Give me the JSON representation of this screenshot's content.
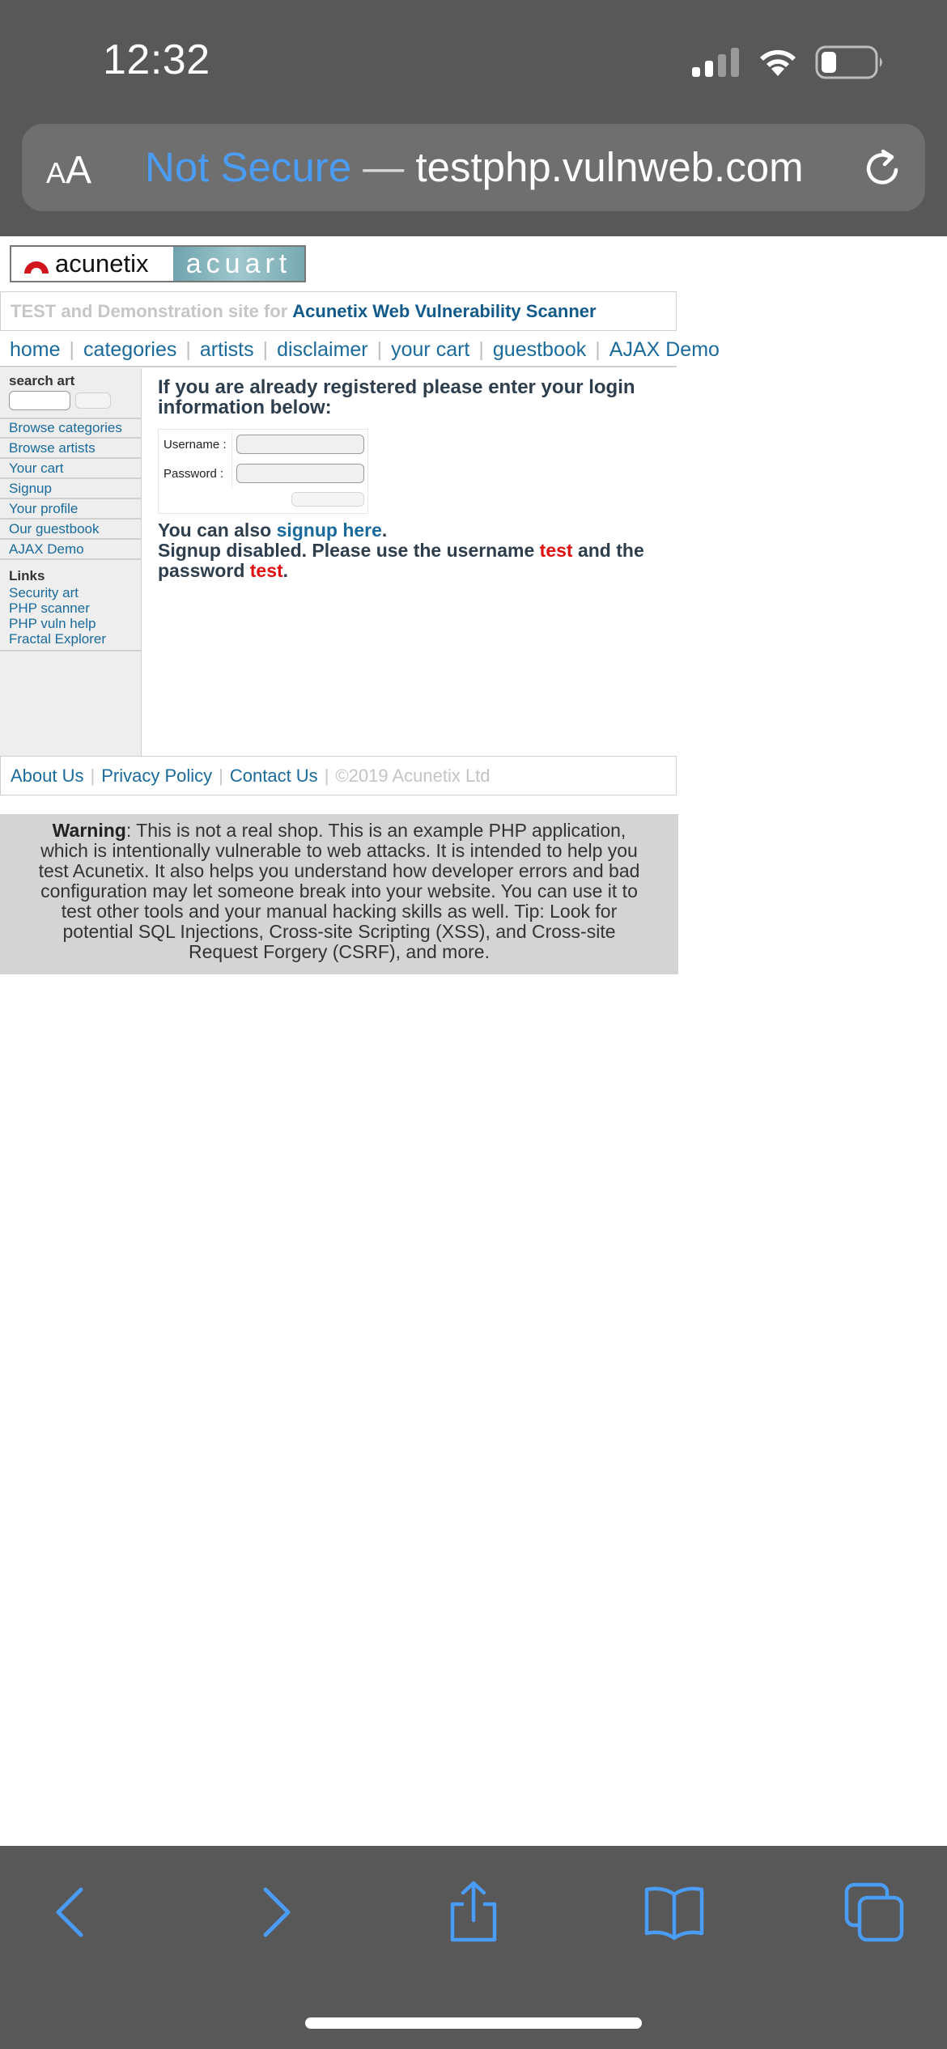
{
  "status_bar": {
    "time": "12:32",
    "icons": [
      "cellular-signal-icon",
      "wifi-icon",
      "battery-icon"
    ]
  },
  "address_bar": {
    "text_size_label_small": "A",
    "text_size_label_big": "A",
    "security_label": "Not Secure",
    "separator": " — ",
    "host": "testphp.vulnweb.com",
    "reload_icon": "reload-icon"
  },
  "site": {
    "logo_left_text": "acunetix",
    "logo_right_text": "acuart",
    "tagline_prefix": "TEST and Demonstration site for",
    "tagline_product": "Acunetix Web Vulnerability Scanner",
    "nav": [
      "home",
      "categories",
      "artists",
      "disclaimer",
      "your cart",
      "guestbook",
      "AJAX Demo"
    ]
  },
  "sidebar": {
    "search_label": "search art",
    "items": [
      "Browse categories",
      "Browse artists",
      "Your cart",
      "Signup",
      "Your profile",
      "Our guestbook",
      "AJAX Demo"
    ],
    "links_heading": "Links",
    "links": [
      "Security art",
      "PHP scanner",
      "PHP vuln help",
      "Fractal Explorer"
    ]
  },
  "login": {
    "title": "If you are already registered please enter your login information below:",
    "username_label": "Username :",
    "password_label": "Password :"
  },
  "signup": {
    "also_text": "You can also",
    "signup_link": "signup here",
    "period": ".",
    "disabled_text": "Signup disabled. Please use the username",
    "username_value": "test",
    "and_text": "and the password",
    "password_value": "test",
    "end": "."
  },
  "footer": {
    "links": [
      "About Us",
      "Privacy Policy",
      "Contact Us"
    ],
    "copyright": "©2019 Acunetix Ltd"
  },
  "warning": {
    "label": "Warning",
    "text": ": This is not a real shop. This is an example PHP application, which is intentionally vulnerable to web attacks. It is intended to help you test Acunetix. It also helps you understand how developer errors and bad configuration may let someone break into your website. You can use it to test other tools and your manual hacking skills as well. Tip: Look for potential SQL Injections, Cross-site Scripting (XSS), and Cross-site Request Forgery (CSRF), and more."
  },
  "toolbar": {
    "icons": [
      "back-icon",
      "forward-icon",
      "share-icon",
      "bookmarks-icon",
      "tabs-icon"
    ]
  },
  "colors": {
    "chrome_background": "#585858",
    "accent_blue": "#4a9cf5",
    "link_blue": "#1a6b9c",
    "highlight_red": "#e01010"
  }
}
